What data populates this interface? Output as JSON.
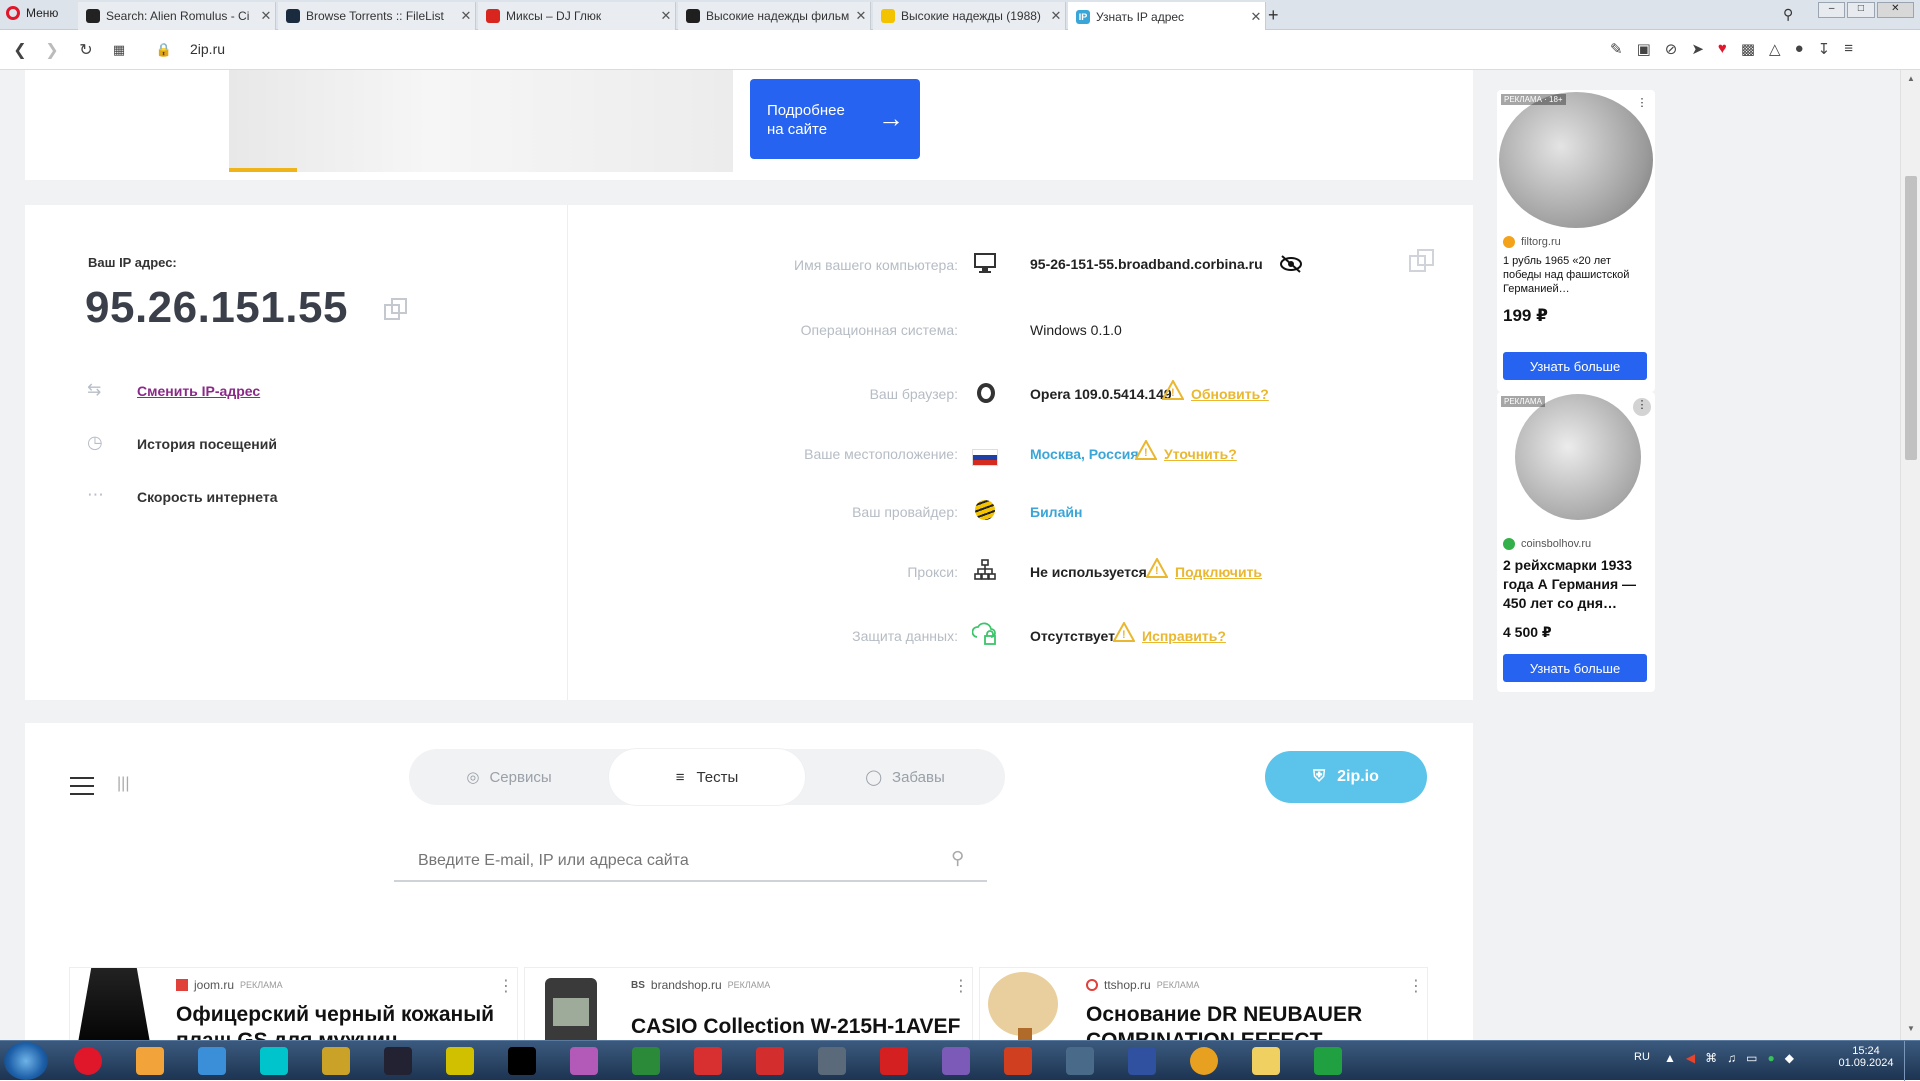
{
  "browser": {
    "menu_label": "Меню",
    "tabs": [
      {
        "title": "Search: Alien Romulus - Ci",
        "fav_color": "#222"
      },
      {
        "title": "Browse Torrents :: FileList",
        "fav_color": "#1b2b3f"
      },
      {
        "title": "Миксы – DJ Глюк",
        "fav_color": "#d8251d"
      },
      {
        "title": "Высокие надежды фильм",
        "fav_color": "#1f1f1f"
      },
      {
        "title": "Высокие надежды (1988)",
        "fav_color": "#f3c300"
      },
      {
        "title": "Узнать IP адрес",
        "fav_color": "#3aa6d8",
        "fav_text": "IP"
      }
    ],
    "new_tab_label": "+",
    "url": "2ip.ru"
  },
  "promo": {
    "button_label": "Подробнее на сайте",
    "button_line1": "Подробнее",
    "button_line2": "на сайте"
  },
  "ip_card": {
    "title": "Ваш IP адрес:",
    "ip": "95.26.151.55",
    "links": [
      {
        "label": "Сменить IP-адрес",
        "icon": "change-ip-icon"
      },
      {
        "label": "История посещений",
        "icon": "history-icon"
      },
      {
        "label": "Скорость интернета",
        "icon": "speed-icon"
      }
    ]
  },
  "info": {
    "computer": {
      "label": "Имя вашего компьютера:",
      "value": "95-26-151-55.broadband.corbina.ru"
    },
    "os": {
      "label": "Операционная система:",
      "value": "Windows 0.1.0"
    },
    "browser": {
      "label": "Ваш браузер:",
      "value": "Opera 109.0.5414.149",
      "action": "Обновить?"
    },
    "location": {
      "label": "Ваше местоположение:",
      "value": "Москва, Россия",
      "action": "Уточнить?"
    },
    "provider": {
      "label": "Ваш провайдер:",
      "value": "Билайн"
    },
    "proxy": {
      "label": "Прокси:",
      "value": "Не используется",
      "action": "Подключить"
    },
    "protection": {
      "label": "Защита данных:",
      "value": "Отсутствует",
      "action": "Исправить?"
    }
  },
  "nav": {
    "segments": [
      "Сервисы",
      "Тесты",
      "Забавы"
    ],
    "active_segment": "Тесты",
    "brand_button": "2ip.io",
    "search_placeholder": "Введите E-mail, IP или адреса сайта"
  },
  "side_ads": [
    {
      "badge": "РЕКЛАМА · 18+",
      "source": "filtorg.ru",
      "title": "1 рубль 1965 «20 лет победы над фашистской Германией…",
      "price": "199 ₽",
      "button": "Узнать больше"
    },
    {
      "badge": "РЕКЛАМА",
      "source": "coinsbolhov.ru",
      "title": "2 рейхсмарки 1933 года А Германия — 450 лет со дня…",
      "price": "4 500 ₽",
      "button": "Узнать больше"
    }
  ],
  "bottom_ads": [
    {
      "source": "joom.ru",
      "badge": "РЕКЛАМА",
      "title": "Офицерский черный кожаный плащ GS для мужчин"
    },
    {
      "source": "brandshop.ru",
      "badge": "РЕКЛАМА",
      "title": "CASIO Collection W-215H-1AVEF"
    },
    {
      "source": "ttshop.ru",
      "badge": "РЕКЛАМА",
      "title": "Основание DR NEUBAUER COMBINATION EFFECT"
    }
  ],
  "taskbar": {
    "lang": "RU",
    "time": "15:24",
    "date": "01.09.2024"
  },
  "colors": {
    "accent": "#3aa6d8",
    "warning": "#e9b730",
    "promo_button": "#2563f0",
    "brand_button": "#5cc3ea"
  }
}
